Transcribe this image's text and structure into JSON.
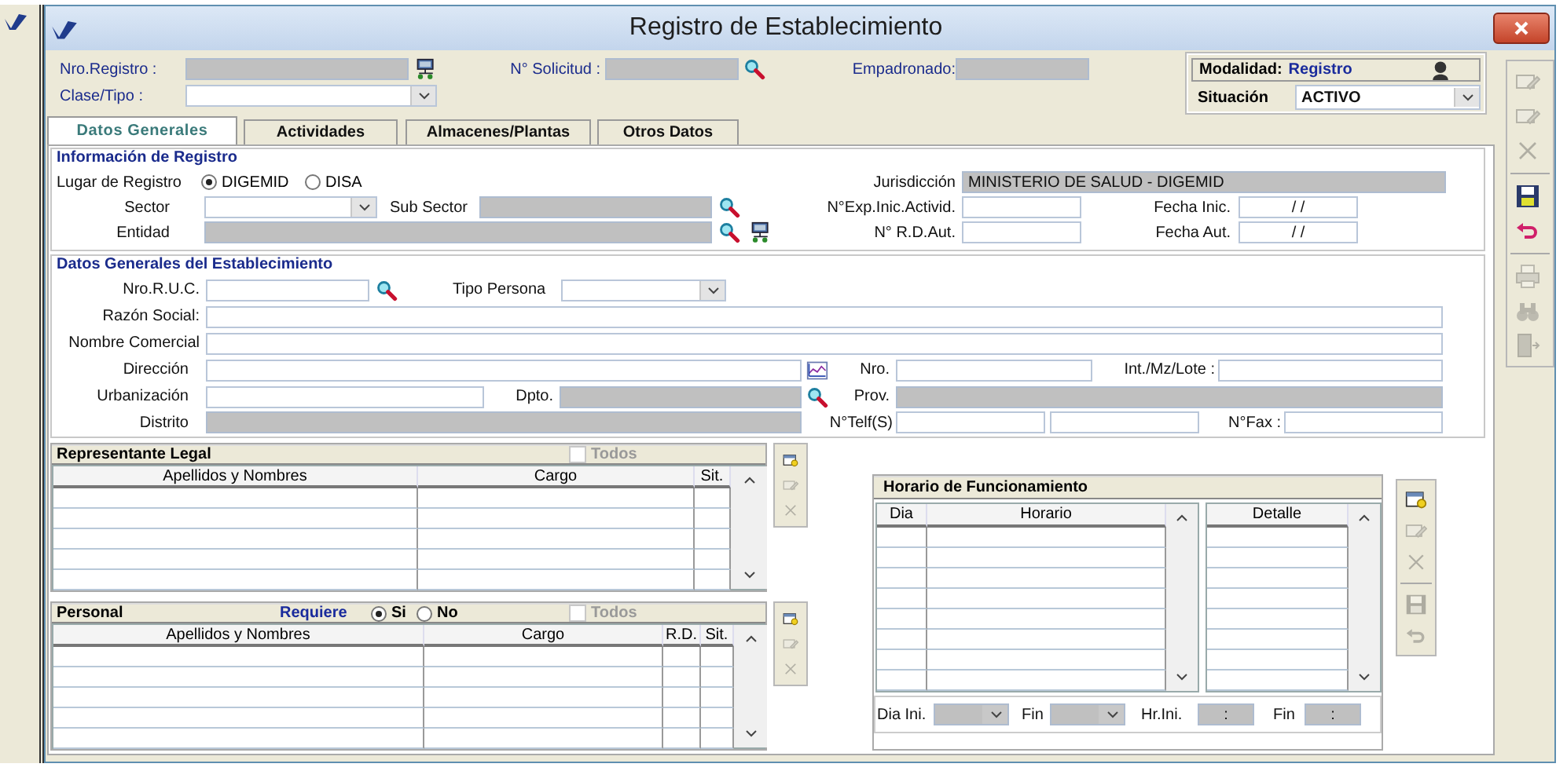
{
  "window": {
    "title": "Registro de Establecimiento"
  },
  "header": {
    "nro_registro": {
      "label": "Nro.Registro :",
      "kind": "readonly"
    },
    "solicitud": {
      "label": "N° Solicitud :",
      "kind": "readonly"
    },
    "empadronado": {
      "label": "Empadronado:",
      "kind": "readonly"
    },
    "clase_tipo": {
      "label": "Clase/Tipo :",
      "kind": "combo"
    },
    "modalidad": {
      "label": "Modalidad:",
      "value": "Registro"
    },
    "situacion": {
      "label": "Situación",
      "value": "ACTIVO",
      "kind": "combo"
    }
  },
  "tabs": [
    {
      "label": "Datos Generales",
      "selected": true
    },
    {
      "label": "Actividades",
      "selected": false
    },
    {
      "label": "Almacenes/Plantas",
      "selected": false
    },
    {
      "label": "Otros Datos",
      "selected": false
    }
  ],
  "registro": {
    "title": "Información de Registro",
    "lugar": {
      "label": "Lugar de Registro",
      "options": [
        {
          "label": "DIGEMID",
          "selected": true
        },
        {
          "label": "DISA",
          "selected": false
        }
      ]
    },
    "jurisdiccion": {
      "label": "Jurisdicción",
      "value": "MINISTERIO DE SALUD - DIGEMID",
      "kind": "readonly"
    },
    "sector": {
      "label": "Sector",
      "kind": "combo"
    },
    "sub_sector": {
      "label": "Sub Sector",
      "kind": "readonly"
    },
    "exp": {
      "label": "N°Exp.Inic.Activid.",
      "kind": "text"
    },
    "fecha_inic": {
      "label": "Fecha Inic.",
      "value": "/ /",
      "kind": "text"
    },
    "entidad": {
      "label": "Entidad",
      "kind": "readonly"
    },
    "rd_aut": {
      "label": "N° R.D.Aut.",
      "kind": "text"
    },
    "fecha_aut": {
      "label": "Fecha Aut.",
      "value": "/ /",
      "kind": "text"
    }
  },
  "establecimiento": {
    "title": "Datos Generales del Establecimiento",
    "ruc": {
      "label": "Nro.R.U.C.",
      "kind": "text"
    },
    "tipo_persona": {
      "label": "Tipo Persona",
      "kind": "combo"
    },
    "razon_social": {
      "label": "Razón Social:",
      "kind": "text"
    },
    "nombre_comercial": {
      "label": "Nombre Comercial",
      "kind": "text"
    },
    "direccion": {
      "label": "Dirección",
      "kind": "text"
    },
    "nro": {
      "label": "Nro.",
      "kind": "text"
    },
    "int_lote": {
      "label": "Int./Mz/Lote :",
      "kind": "text"
    },
    "urbanizacion": {
      "label": "Urbanización",
      "kind": "text"
    },
    "dpto": {
      "label": "Dpto.",
      "kind": "readonly"
    },
    "prov": {
      "label": "Prov.",
      "kind": "readonly"
    },
    "distrito": {
      "label": "Distrito",
      "kind": "readonly"
    },
    "telefonos": {
      "label": "N°Telf(S)",
      "fields": [
        {
          "kind": "text"
        },
        {
          "kind": "text"
        }
      ]
    },
    "fax": {
      "label": "N°Fax :",
      "kind": "text"
    }
  },
  "representante": {
    "title": "Representante Legal",
    "todos": {
      "label": "Todos",
      "checked": false,
      "disabled": true
    },
    "columns": [
      "Apellidos y Nombres",
      "Cargo",
      "Sit."
    ],
    "tools": [
      {
        "disabled": false
      },
      {
        "disabled": true
      },
      {
        "disabled": true
      }
    ]
  },
  "personal": {
    "title": "Personal",
    "requiere": {
      "label": "Requiere",
      "options": [
        {
          "label": "Si",
          "selected": true
        },
        {
          "label": "No",
          "selected": false
        }
      ]
    },
    "todos": {
      "label": "Todos",
      "checked": false,
      "disabled": true
    },
    "columns": [
      "Apellidos y Nombres",
      "Cargo",
      "R.D.",
      "Sit."
    ],
    "tools": [
      {
        "disabled": false
      },
      {
        "disabled": true
      },
      {
        "disabled": true
      }
    ]
  },
  "horario": {
    "title": "Horario de Funcionamiento",
    "columns": [
      "Dia",
      "Horario"
    ],
    "detalle_columns": [
      "Detalle"
    ],
    "dia_ini": {
      "label": "Dia Ini.",
      "kind": "combo",
      "disabled": true
    },
    "dia_fin": {
      "label": "Fin",
      "kind": "combo",
      "disabled": true
    },
    "hr_ini": {
      "label": "Hr.Ini.",
      "value": ":",
      "kind": "readonly"
    },
    "hr_fin": {
      "label": "Fin",
      "value": ":",
      "kind": "readonly"
    },
    "tools": [
      {
        "disabled": false
      },
      {
        "disabled": true
      },
      {
        "disabled": true
      },
      {
        "disabled": true
      },
      {
        "disabled": true
      }
    ]
  },
  "toolbar": [
    {
      "disabled": true
    },
    {
      "disabled": true
    },
    {
      "disabled": true
    },
    {
      "disabled": false
    },
    {
      "disabled": false
    },
    {
      "disabled": true
    },
    {
      "disabled": true
    },
    {
      "disabled": true
    }
  ]
}
